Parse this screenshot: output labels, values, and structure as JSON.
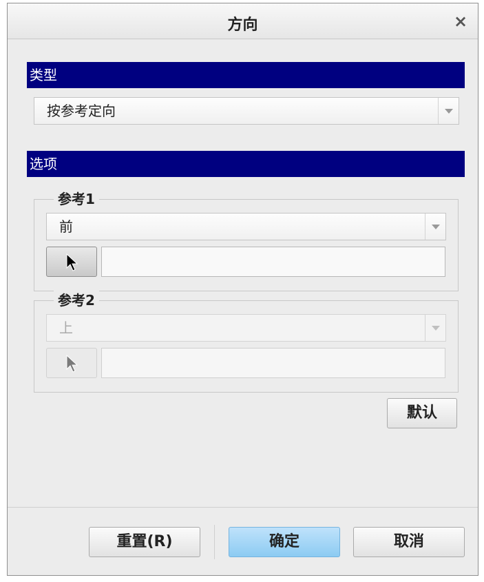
{
  "window": {
    "title": "方向",
    "close_label": "×"
  },
  "type_section": {
    "header": "类型",
    "dropdown_value": "按参考定向"
  },
  "options_section": {
    "header": "选项",
    "reference1": {
      "legend": "参考1",
      "dropdown_value": "前",
      "field_value": ""
    },
    "reference2": {
      "legend": "参考2",
      "dropdown_value": "上",
      "field_value": "",
      "enabled": false
    },
    "default_button": "默认"
  },
  "footer": {
    "reset_button": "重置(R)",
    "ok_button": "确定",
    "cancel_button": "取消"
  },
  "colors": {
    "section_header_bg": "#000080",
    "primary_button": "#8ccbf2",
    "dialog_bg": "#ececec"
  },
  "icons": {
    "picker": "select-arrow-icon",
    "dropdown": "chevron-down-icon",
    "close": "close-icon"
  }
}
